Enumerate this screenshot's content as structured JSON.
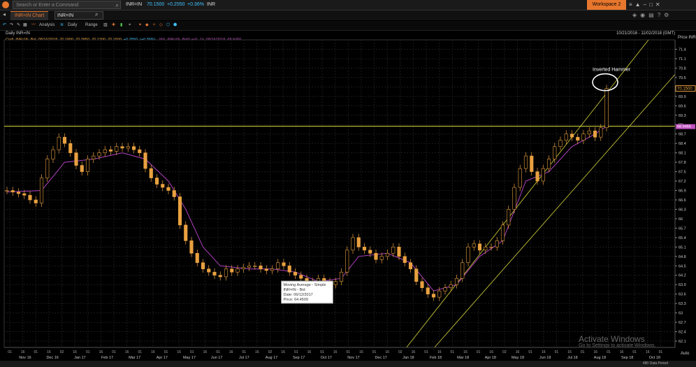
{
  "topbar": {
    "search_placeholder": "Search or Enter a Command",
    "ric": "INR=IN",
    "last": "70.1500",
    "change": "+0.2550",
    "pct_change": "+0.36%",
    "ric_tail": "INR",
    "workspace": "Workspace 2",
    "colors": {
      "last": "#3fc3ff",
      "up": "#3fc3ff"
    }
  },
  "tabs": {
    "active_label": "INR=IN Chart",
    "ric_input": "INR=IN"
  },
  "toolbar": {
    "analysis": "Analysis",
    "daily": "Daily",
    "range": "Range"
  },
  "header": {
    "title": "Daily INR=IN",
    "date_range": "10/21/2016 - 11/02/2018 (GMT)"
  },
  "legend": {
    "price_series": "Cndl, INR=IN, Bid, 08/16/2018, 70.1900, 70.3850, 70.1300, 70.1500,",
    "price_change": "+0.2550, (+0.36%)",
    "ma_series": "MA, INR=IN, Bid(Last), 14, 08/16/2018, 68.9466",
    "colors": {
      "price": "#e8a040",
      "change": "#3fc3ff",
      "ma": "#c050c0"
    }
  },
  "chart_data": {
    "type": "candlestick",
    "ylabel": "Price INR",
    "ylim": [
      61.9,
      71.7
    ],
    "yticks": [
      62.1,
      62.4,
      62.7,
      63,
      63.3,
      63.6,
      63.9,
      64.2,
      64.5,
      64.8,
      65.1,
      65.4,
      65.7,
      66,
      66.3,
      66.6,
      66.9,
      67.2,
      67.5,
      67.8,
      68.1,
      68.4,
      68.7,
      69,
      69.3,
      69.6,
      69.9,
      70.2,
      70.5,
      70.8,
      71.1,
      71.4
    ],
    "ytick_labels": [
      "62.1",
      "62.4",
      "62.7",
      "63",
      "63.3",
      "63.6",
      "63.9",
      "64.2",
      "64.5",
      "64.8",
      "65.1",
      "65.4",
      "65.7",
      "66",
      "66.3",
      "66.6",
      "66.9",
      "67.2",
      "67.5",
      "67.8",
      "68.1",
      "68.4",
      "68.7",
      "69",
      "69.3",
      "69.6",
      "69.9",
      "70.2",
      "70.5",
      "70.8",
      "71.1",
      "71.4"
    ],
    "xlabels_days": [
      "01",
      "16",
      "01",
      "16",
      "02",
      "16",
      "01",
      "16",
      "01",
      "16",
      "01",
      "16",
      "01",
      "16",
      "01",
      "16",
      "01",
      "16",
      "01",
      "16",
      "02",
      "16",
      "01",
      "16",
      "01",
      "16",
      "01",
      "16",
      "01",
      "16",
      "02",
      "16",
      "01",
      "16",
      "01",
      "16",
      "01",
      "16",
      "02",
      "16",
      "01",
      "16",
      "01",
      "16",
      "01",
      "16",
      "01",
      "16",
      "01",
      "16",
      "01"
    ],
    "xlabels_months": [
      "Nov 16",
      "Dec 16",
      "Jan 17",
      "Feb 17",
      "Mar 17",
      "Apr 17",
      "May 17",
      "Jun 17",
      "Jul 17",
      "Aug 17",
      "Sep 17",
      "Oct 17",
      "Nov 17",
      "Dec 17",
      "Jan 18",
      "Feb 18",
      "Mar 18",
      "Apr 18",
      "May 18",
      "Jun 18",
      "Jul 18",
      "Aug 18",
      "Sep 18",
      "Oct 18"
    ],
    "series": [
      {
        "name": "INR=IN",
        "points": [
          [
            0,
            66.9
          ],
          [
            1,
            66.85
          ],
          [
            2,
            66.8
          ],
          [
            3,
            66.75
          ],
          [
            4,
            66.6
          ],
          [
            5,
            66.5
          ],
          [
            6,
            67.3
          ],
          [
            7,
            67.9
          ],
          [
            8,
            68.2
          ],
          [
            9,
            68.6
          ],
          [
            10,
            68.4
          ],
          [
            11,
            68.1
          ],
          [
            12,
            67.7
          ],
          [
            13,
            67.5
          ],
          [
            14,
            67.9
          ],
          [
            15,
            68.0
          ],
          [
            16,
            68.1
          ],
          [
            17,
            68.2
          ],
          [
            18,
            68.15
          ],
          [
            19,
            68.3
          ],
          [
            20,
            68.25
          ],
          [
            21,
            68.3
          ],
          [
            22,
            68.2
          ],
          [
            23,
            68.1
          ],
          [
            24,
            67.6
          ],
          [
            25,
            67.3
          ],
          [
            26,
            67.1
          ],
          [
            27,
            67.0
          ],
          [
            28,
            66.9
          ],
          [
            29,
            66.7
          ],
          [
            30,
            65.8
          ],
          [
            31,
            65.3
          ],
          [
            32,
            64.9
          ],
          [
            33,
            64.6
          ],
          [
            34,
            64.4
          ],
          [
            35,
            64.3
          ],
          [
            36,
            64.2
          ],
          [
            37,
            64.15
          ],
          [
            38,
            64.4
          ],
          [
            39,
            64.3
          ],
          [
            40,
            64.4
          ],
          [
            41,
            64.45
          ],
          [
            42,
            64.5
          ],
          [
            43,
            64.5
          ],
          [
            44,
            64.4
          ],
          [
            45,
            64.35
          ],
          [
            46,
            64.4
          ],
          [
            47,
            64.6
          ],
          [
            48,
            64.5
          ],
          [
            49,
            64.3
          ],
          [
            50,
            64.2
          ],
          [
            51,
            64.1
          ],
          [
            52,
            64.0
          ],
          [
            53,
            63.9
          ],
          [
            54,
            64.1
          ],
          [
            55,
            64.0
          ],
          [
            56,
            63.9
          ],
          [
            57,
            64.0
          ],
          [
            58,
            64.3
          ],
          [
            59,
            65.0
          ],
          [
            60,
            65.4
          ],
          [
            61,
            65.1
          ],
          [
            62,
            65.0
          ],
          [
            63,
            64.9
          ],
          [
            64,
            64.7
          ],
          [
            65,
            64.8
          ],
          [
            66,
            64.9
          ],
          [
            67,
            65.1
          ],
          [
            68,
            64.8
          ],
          [
            69,
            64.6
          ],
          [
            70,
            64.4
          ],
          [
            71,
            64.0
          ],
          [
            72,
            63.8
          ],
          [
            73,
            63.6
          ],
          [
            74,
            63.5
          ],
          [
            75,
            63.7
          ],
          [
            76,
            63.8
          ],
          [
            77,
            63.9
          ],
          [
            78,
            64.1
          ],
          [
            79,
            64.6
          ],
          [
            80,
            65.1
          ],
          [
            81,
            65.2
          ],
          [
            82,
            65.0
          ],
          [
            83,
            65.1
          ],
          [
            84,
            65.1
          ],
          [
            85,
            65.3
          ],
          [
            86,
            65.8
          ],
          [
            87,
            66.3
          ],
          [
            88,
            67.0
          ],
          [
            89,
            67.6
          ],
          [
            90,
            68.0
          ],
          [
            91,
            67.5
          ],
          [
            92,
            67.2
          ],
          [
            93,
            67.6
          ],
          [
            94,
            67.9
          ],
          [
            95,
            68.3
          ],
          [
            96,
            68.5
          ],
          [
            97,
            68.7
          ],
          [
            98,
            68.6
          ],
          [
            99,
            68.5
          ],
          [
            100,
            68.7
          ],
          [
            101,
            68.8
          ],
          [
            102,
            68.6
          ],
          [
            103,
            68.9
          ],
          [
            104,
            70.15
          ]
        ]
      },
      {
        "name": "MA 14",
        "type": "line",
        "points": [
          [
            0,
            66.85
          ],
          [
            6,
            66.9
          ],
          [
            10,
            67.8
          ],
          [
            15,
            67.9
          ],
          [
            20,
            68.1
          ],
          [
            24,
            67.9
          ],
          [
            28,
            67.2
          ],
          [
            31,
            66.3
          ],
          [
            34,
            65.1
          ],
          [
            37,
            64.5
          ],
          [
            42,
            64.4
          ],
          [
            46,
            64.4
          ],
          [
            50,
            64.3
          ],
          [
            54,
            64.0
          ],
          [
            58,
            64.1
          ],
          [
            61,
            64.8
          ],
          [
            66,
            64.9
          ],
          [
            70,
            64.6
          ],
          [
            74,
            63.7
          ],
          [
            78,
            63.9
          ],
          [
            82,
            64.8
          ],
          [
            86,
            65.3
          ],
          [
            90,
            67.2
          ],
          [
            94,
            67.5
          ],
          [
            98,
            68.3
          ],
          [
            102,
            68.7
          ],
          [
            104,
            68.9466
          ]
        ]
      }
    ],
    "horizontal_line": 68.95,
    "last_price_label": "70.1500",
    "ma_label": "68.9466",
    "annotation": "Inverted Hammer",
    "tooltip": {
      "title": "Moving Average - Simple",
      "ric": "INR=IN - Bid",
      "date_label": "Date:",
      "date": "06/12/2017",
      "price_label": "Price:",
      "price": "64.4509"
    },
    "grid": true,
    "axis_mode": "Auto"
  },
  "statusbar": {
    "periods": "480 Data Period"
  },
  "watermark": {
    "line1": "Activate Windows",
    "line2": "Go to Settings to activate Windows."
  }
}
